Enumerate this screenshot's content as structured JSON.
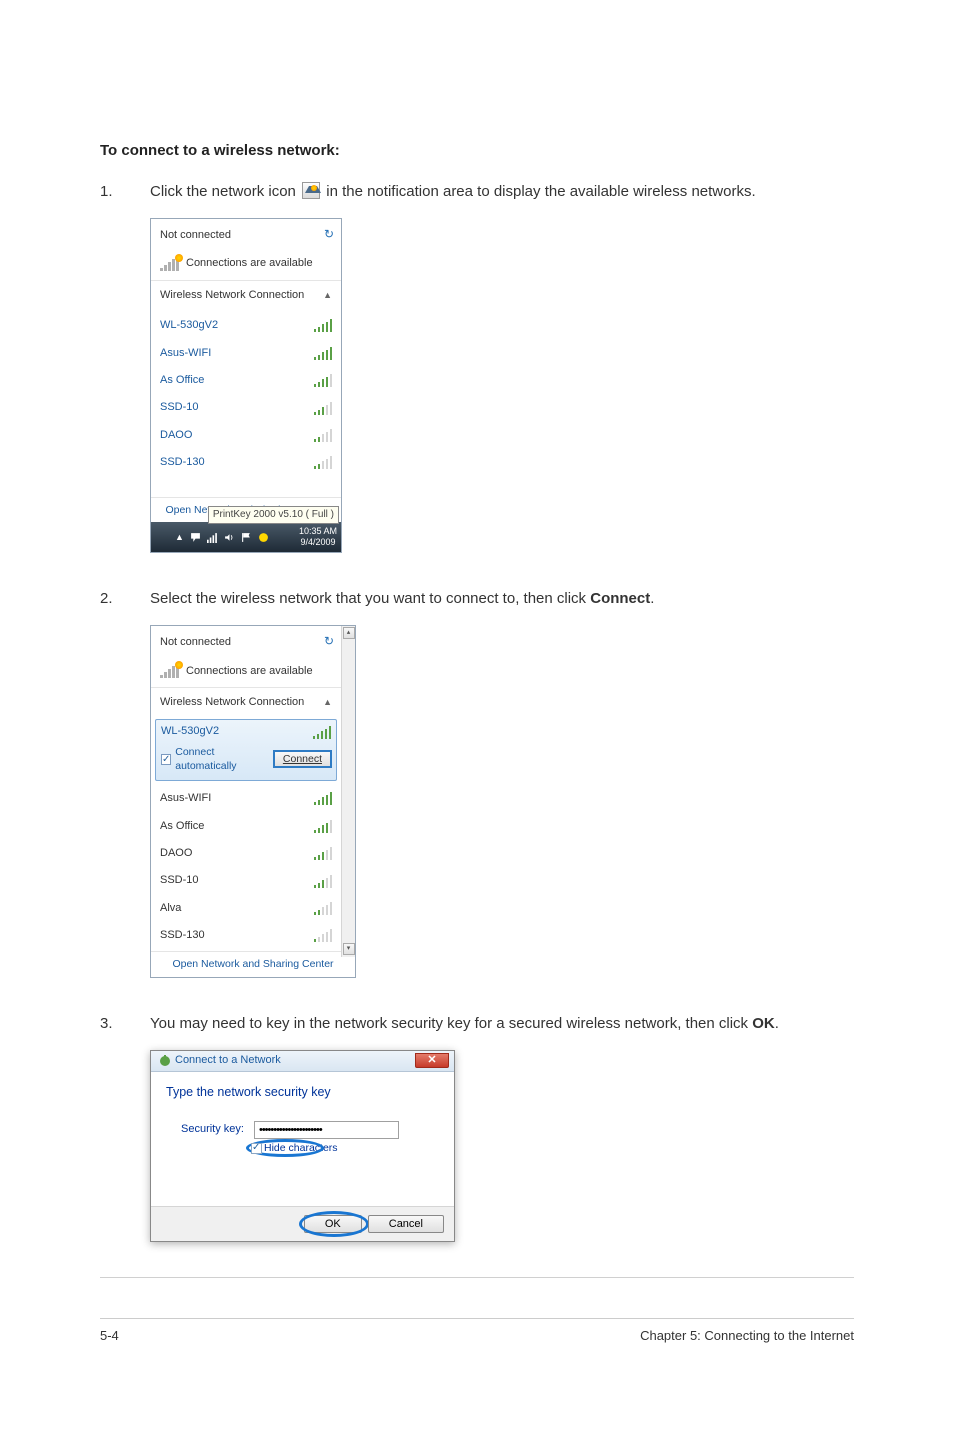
{
  "section_title": "To connect to a wireless network:",
  "step1": {
    "num": "1.",
    "pre": "Click the network icon ",
    "post": " in the notification area to display the available wireless networks."
  },
  "step2": {
    "num": "2.",
    "pre": "Select the wireless network that you want to connect to, then click ",
    "bold": "Connect",
    "post": "."
  },
  "step3": {
    "num": "3.",
    "pre": "You may need to key in the network security key for a secured wireless network, then click ",
    "bold": "OK",
    "post": "."
  },
  "panel1": {
    "not_connected": "Not connected",
    "conns_avail": "Connections are available",
    "wnc": "Wireless Network Connection",
    "networks": [
      "WL-530gV2",
      "Asus-WIFI",
      "As Office",
      "SSD-10",
      "DAOO",
      "SSD-130"
    ],
    "open_link": "Open Network and Sharing Center",
    "tooltip": "PrintKey 2000  v5.10 ( Full )",
    "time": "10:35 AM",
    "date": "9/4/2009"
  },
  "panel2": {
    "not_connected": "Not connected",
    "conns_avail": "Connections are available",
    "wnc": "Wireless Network Connection",
    "selected_net": "WL-530gV2",
    "auto_label": "Connect automatically",
    "connect_btn": "Connect",
    "networks": [
      "Asus-WIFI",
      "As Office",
      "DAOO",
      "SSD-10",
      "Alva",
      "SSD-130"
    ],
    "open_link": "Open Network and Sharing Center"
  },
  "dialog": {
    "title": "Connect to a Network",
    "heading": "Type the network security key",
    "key_label": "Security key:",
    "key_value": "••••••••••••••••••••••",
    "hide_label": "Hide characters",
    "ok": "OK",
    "cancel": "Cancel"
  },
  "footer": {
    "left": "5-4",
    "right": "Chapter 5: Connecting to the Internet"
  }
}
